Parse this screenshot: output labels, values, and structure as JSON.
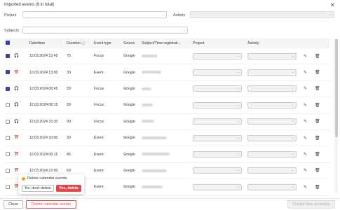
{
  "header": {
    "title": "Imported events (9 in total)"
  },
  "filters": {
    "project_label": "Project",
    "activity_label": "Activity",
    "subjects_label": "Subjects"
  },
  "table": {
    "columns": [
      "Date/time",
      "Duration",
      "Event type",
      "Source",
      "Subject/Time registrati...",
      "Project",
      "Activity"
    ],
    "rows": [
      {
        "checked": true,
        "date": "12.03.2024 13:45",
        "duration": "75",
        "type": "Focus",
        "source": "Google",
        "icon": "headphones-icon"
      },
      {
        "checked": true,
        "date": "12.03.2024 13:00",
        "duration": "30",
        "type": "Event",
        "source": "Google",
        "icon": "calendar-event-icon"
      },
      {
        "checked": true,
        "date": "12.03.2024 08:45",
        "duration": "30",
        "type": "Focus",
        "source": "Google",
        "icon": "headphones-icon"
      },
      {
        "checked": false,
        "date": "12.03.2024 08:15",
        "duration": "30",
        "type": "Focus",
        "source": "Google",
        "icon": "headphones-icon"
      },
      {
        "checked": false,
        "date": "12.03.2024 10:30",
        "duration": "90",
        "type": "Focus",
        "source": "Google",
        "icon": "headphones-icon"
      },
      {
        "checked": false,
        "date": "12.03.2024 10:00",
        "duration": "30",
        "type": "Event",
        "source": "Google",
        "icon": "calendar-event-icon"
      },
      {
        "checked": false,
        "date": "12.03.2024 09:15",
        "duration": "45",
        "type": "Event",
        "source": "Google",
        "icon": "calendar-event-icon"
      },
      {
        "checked": false,
        "date": "12.03.2024 12:00",
        "duration": "60",
        "type": "Event",
        "source": "Google",
        "icon": "calendar-event-icon"
      },
      {
        "checked": false,
        "date": "",
        "duration": "",
        "type": "Event",
        "source": "Google",
        "icon": "calendar-event-icon"
      }
    ]
  },
  "popup": {
    "title": "Delete calendar events",
    "no_label": "No, don't delete",
    "yes_label": "Yes, delete"
  },
  "footer": {
    "close_label": "Close",
    "delete_label": "Delete calendar events",
    "create_label": "Create time record(s)"
  },
  "colors": {
    "accent": "#3a3fb0",
    "danger": "#e04848"
  }
}
